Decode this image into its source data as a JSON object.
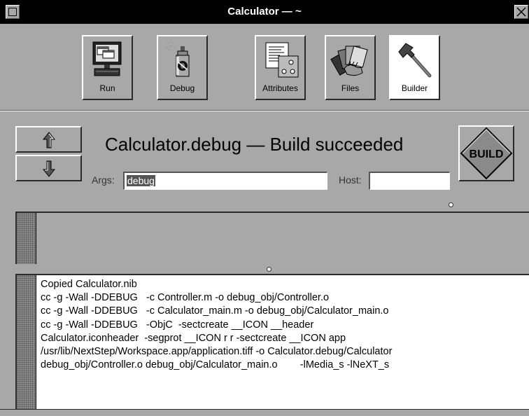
{
  "window": {
    "title": "Calculator — ~"
  },
  "toolbar": {
    "tools": [
      {
        "label": "Run",
        "icon": "computer-monitor-icon"
      },
      {
        "label": "Debug",
        "icon": "bug-spray-can-icon"
      },
      {
        "label": "Attributes",
        "icon": "attributes-inspector-icon"
      },
      {
        "label": "Files",
        "icon": "files-fan-icon"
      },
      {
        "label": "Builder",
        "icon": "hammer-icon",
        "selected": true
      }
    ]
  },
  "status": {
    "heading": "Calculator.debug — Build succeeded",
    "args_label": "Args:",
    "args_value": "debug",
    "host_label": "Host:",
    "host_value": "",
    "build_label": "BUILD",
    "build_color": "#8a8a8a"
  },
  "log": {
    "lines": [
      "Copied Calculator.nib",
      "cc -g -Wall -DDEBUG   -c Controller.m -o debug_obj/Controller.o",
      "cc -g -Wall -DDEBUG   -c Calculator_main.m -o debug_obj/Calculator_main.o",
      "cc -g -Wall -DDEBUG   -ObjC  -sectcreate __ICON __header",
      "Calculator.iconheader  -segprot __ICON r r -sectcreate __ICON app",
      "/usr/lib/NextStep/Workspace.app/application.tiff -o Calculator.debug/Calculator",
      "debug_obj/Controller.o debug_obj/Calculator_main.o        -lMedia_s -lNeXT_s"
    ]
  }
}
